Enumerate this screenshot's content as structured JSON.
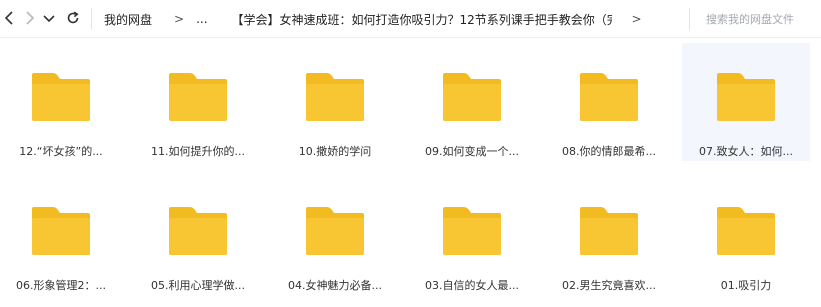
{
  "toolbar": {
    "back_icon": "chevron-left-icon",
    "forward_icon": "chevron-right-icon",
    "dropdown_icon": "chevron-down-icon",
    "refresh_icon": "refresh-icon"
  },
  "breadcrumb": {
    "root": "我的网盘",
    "sep": ">",
    "ellipsis": "...",
    "current": "【学会】女神速成班：如何打造你吸引力？12节系列课手把手教会你（完...",
    "trailing_sep": ">"
  },
  "search": {
    "placeholder": "搜索我的网盘文件"
  },
  "colors": {
    "folder": "#f7c632",
    "folder_tab": "#f3bb22",
    "selected_bg": "#f3f7fd"
  },
  "files": [
    {
      "name": "12.“坏女孩”的...",
      "icon": "folder-icon"
    },
    {
      "name": "11.如何提升你的...",
      "icon": "folder-icon"
    },
    {
      "name": "10.撒娇的学问",
      "icon": "folder-icon"
    },
    {
      "name": "09.如何变成一个...",
      "icon": "folder-icon"
    },
    {
      "name": "08.你的情郎最希...",
      "icon": "folder-icon"
    },
    {
      "name": "07.致女人：如何...",
      "icon": "folder-icon",
      "selected": true
    },
    {
      "name": "06.形象管理2：...",
      "icon": "folder-icon"
    },
    {
      "name": "05.利用心理学做...",
      "icon": "folder-icon"
    },
    {
      "name": "04.女神魅力必备...",
      "icon": "folder-icon"
    },
    {
      "name": "03.自信的女人最...",
      "icon": "folder-icon"
    },
    {
      "name": "02.男生究竟喜欢...",
      "icon": "folder-icon"
    },
    {
      "name": "01.吸引力",
      "icon": "folder-icon"
    }
  ]
}
